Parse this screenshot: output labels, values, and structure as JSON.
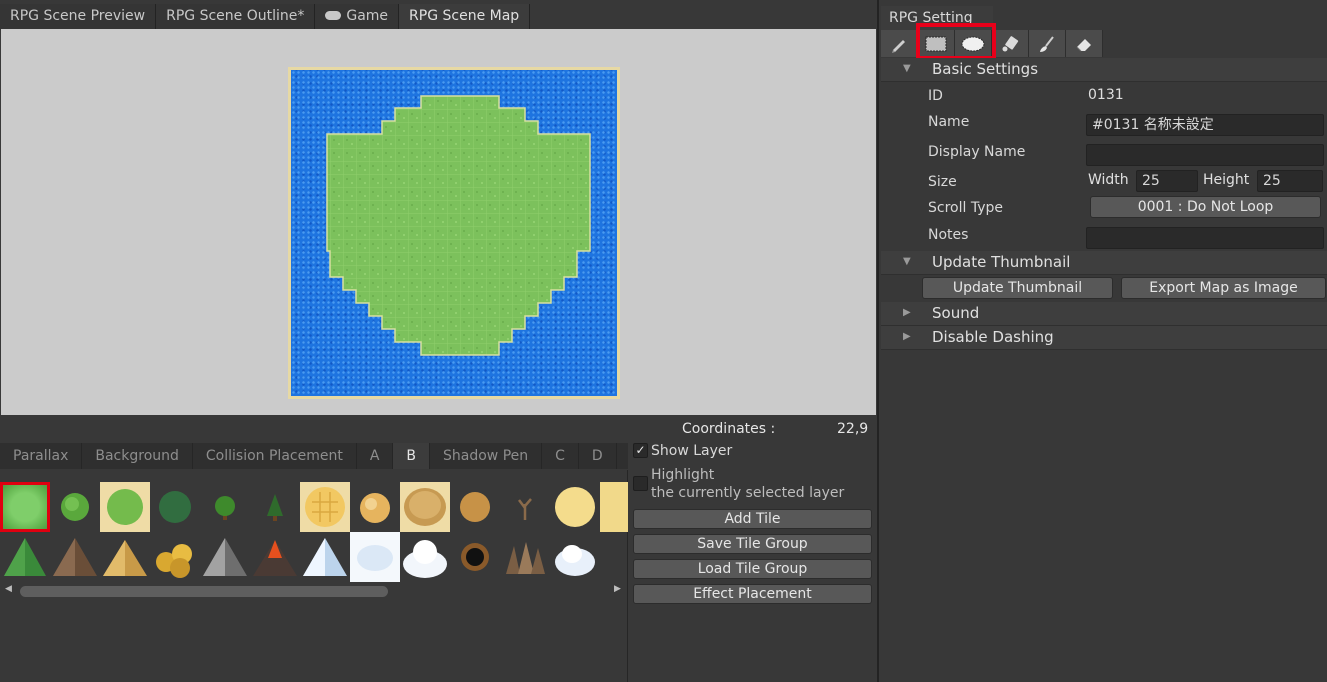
{
  "tabs": {
    "scene_preview": "RPG Scene Preview",
    "scene_outline": "RPG Scene Outline*",
    "game": "Game",
    "scene_map": "RPG Scene Map"
  },
  "coordinates": {
    "label": "Coordinates :",
    "value": "22,9"
  },
  "layer_tabs": [
    "Parallax",
    "Background",
    "Collision Placement",
    "A",
    "B",
    "Shadow Pen",
    "C",
    "D"
  ],
  "layer_panel": {
    "show_layer": "Show Layer",
    "show_layer_checked": true,
    "highlight_line1": "Highlight",
    "highlight_line2": "the currently selected layer",
    "highlight_checked": false,
    "add_tile": "Add Tile",
    "save_tile_group": "Save Tile Group",
    "load_tile_group": "Load Tile Group",
    "effect_placement": "Effect Placement"
  },
  "tile_icons": [
    "grass-tile-icon",
    "bush-tile-icon",
    "grass-patch-tile-icon",
    "dark-grass-tile-icon",
    "tree-tile-icon",
    "pine-tile-icon",
    "hex-sand-tile-icon",
    "sand-rock-tile-icon",
    "sand-mound-tile-icon",
    "dust-tile-icon",
    "dead-tree-tile-icon",
    "sand-circle-tile-icon",
    "sand-edge-tile-icon",
    "forest-tile-icon",
    "rock-mountain-tile-icon",
    "gold-rock-tile-icon",
    "gold-coins-tile-icon",
    "gray-mountain-tile-icon",
    "volcano-tile-icon",
    "snow-mountain-tile-icon",
    "snow-cloud-tile-icon",
    "snow-mound-tile-icon",
    "hole-tile-icon",
    "rock-spikes-tile-icon",
    "snow-rock-tile-icon"
  ],
  "right": {
    "tab": "RPG Setting",
    "tools": [
      "pencil-icon",
      "rectangle-icon",
      "ellipse-icon",
      "fill-bucket-icon",
      "brush-icon",
      "eraser-icon"
    ],
    "basic_settings": "Basic Settings",
    "id_label": "ID",
    "id_value": "0131",
    "name_label": "Name",
    "name_value": "#0131 名称未設定",
    "display_name_label": "Display Name",
    "display_name_value": "",
    "size_label": "Size",
    "width_label": "Width",
    "width_value": "25",
    "height_label": "Height",
    "height_value": "25",
    "scroll_type_label": "Scroll Type",
    "scroll_type_value": "0001 : Do Not Loop",
    "notes_label": "Notes",
    "notes_value": "",
    "update_thumbnail_section": "Update Thumbnail",
    "update_thumbnail_button": "Update Thumbnail",
    "export_map_button": "Export Map as Image",
    "sound_section": "Sound",
    "disable_dashing_section": "Disable Dashing"
  },
  "colors": {
    "highlight_red": "#e8001a",
    "water_blue": "#1e74e0",
    "grass_green": "#7cc15c",
    "sand_border": "#e7d9a4"
  }
}
